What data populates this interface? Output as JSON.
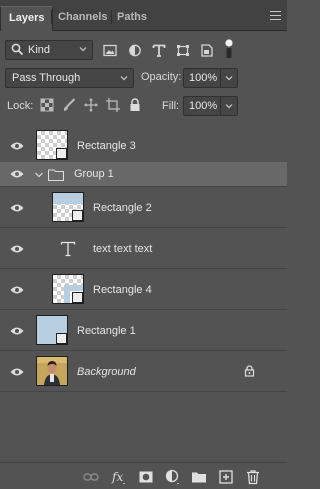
{
  "tabs": [
    {
      "label": "Layers",
      "active": true
    },
    {
      "label": "Channels",
      "active": false
    },
    {
      "label": "Paths",
      "active": false
    }
  ],
  "filter": {
    "kind_label": "Kind",
    "icons": [
      "image-filter-icon",
      "adjustment-filter-icon",
      "type-filter-icon",
      "shape-filter-icon",
      "smart-object-filter-icon",
      "filter-toggle-icon"
    ]
  },
  "blend": {
    "mode": "Pass Through",
    "opacity_label": "Opacity:",
    "opacity_value": "100%",
    "fill_label": "Fill:",
    "fill_value": "100%"
  },
  "lock": {
    "label": "Lock:",
    "icons": [
      "lock-transparent-pixels-icon",
      "lock-image-pixels-icon",
      "lock-position-icon",
      "lock-artboard-icon",
      "lock-all-icon"
    ]
  },
  "layers": [
    {
      "name": "Rectangle 3",
      "type": "shape",
      "thumb": "checker",
      "indent": 0,
      "selected": false
    },
    {
      "name": "Group 1",
      "type": "group",
      "indent": 0,
      "selected": true,
      "expanded": true
    },
    {
      "name": "Rectangle 2",
      "type": "shape",
      "thumb": "blue-top",
      "indent": 1,
      "selected": false
    },
    {
      "name": "text text text",
      "type": "text",
      "indent": 1,
      "selected": false
    },
    {
      "name": "Rectangle 4",
      "type": "shape",
      "thumb": "blue-corner",
      "indent": 1,
      "selected": false
    },
    {
      "name": "Rectangle 1",
      "type": "shape",
      "thumb": "blue-full",
      "indent": 0,
      "selected": false
    },
    {
      "name": "Background",
      "type": "background",
      "thumb": "photo",
      "indent": 0,
      "selected": false,
      "locked": true
    }
  ],
  "bottom_icons": [
    "link-layers-icon",
    "fx-icon",
    "mask-icon",
    "adjustment-layer-icon",
    "new-group-icon",
    "new-layer-icon",
    "delete-icon"
  ],
  "colors": {
    "panel_bg": "#535353",
    "selected_row": "#686868",
    "thumb_blue": "#b7cde0"
  }
}
